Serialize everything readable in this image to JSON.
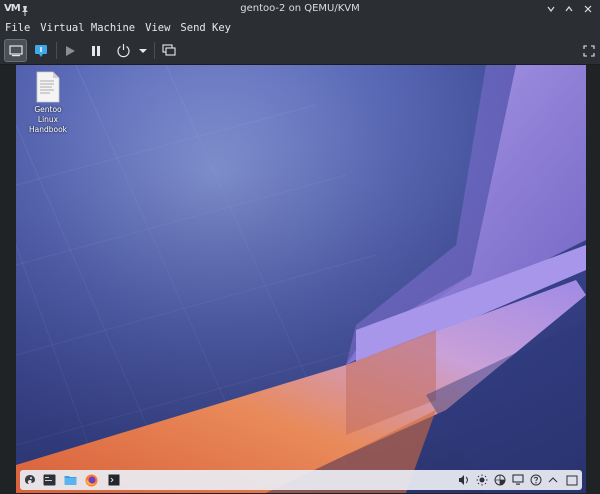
{
  "window": {
    "title": "gentoo-2 on QEMU/KVM",
    "app_logo": "VM"
  },
  "menu": {
    "items": [
      "File",
      "Virtual Machine",
      "View",
      "Send Key"
    ]
  },
  "toolbar": {
    "buttons": [
      "console-icon",
      "details-icon",
      "run-icon",
      "pause-icon",
      "power-icon",
      "power-menu-icon",
      "snapshots-icon",
      "fullscreen-icon"
    ]
  },
  "desktop": {
    "icons": [
      {
        "label_line1": "Gentoo Linux",
        "label_line2": "Handbook"
      }
    ]
  },
  "panel": {
    "launchers": [
      "application-launcher-icon",
      "terminal-icon",
      "file-manager-icon",
      "firefox-icon",
      "konsole-icon"
    ],
    "tray": [
      "volume-icon",
      "brightness-icon",
      "network-icon",
      "display-icon",
      "help-icon",
      "tray-expand-icon",
      "show-desktop-icon"
    ]
  },
  "colors": {
    "chrome": "#2b2f33",
    "wallpaper_blue": "#3d4a96",
    "wallpaper_violet": "#8f7fd6",
    "wallpaper_orange": "#e0784a",
    "panel": "#e9ecf2"
  }
}
